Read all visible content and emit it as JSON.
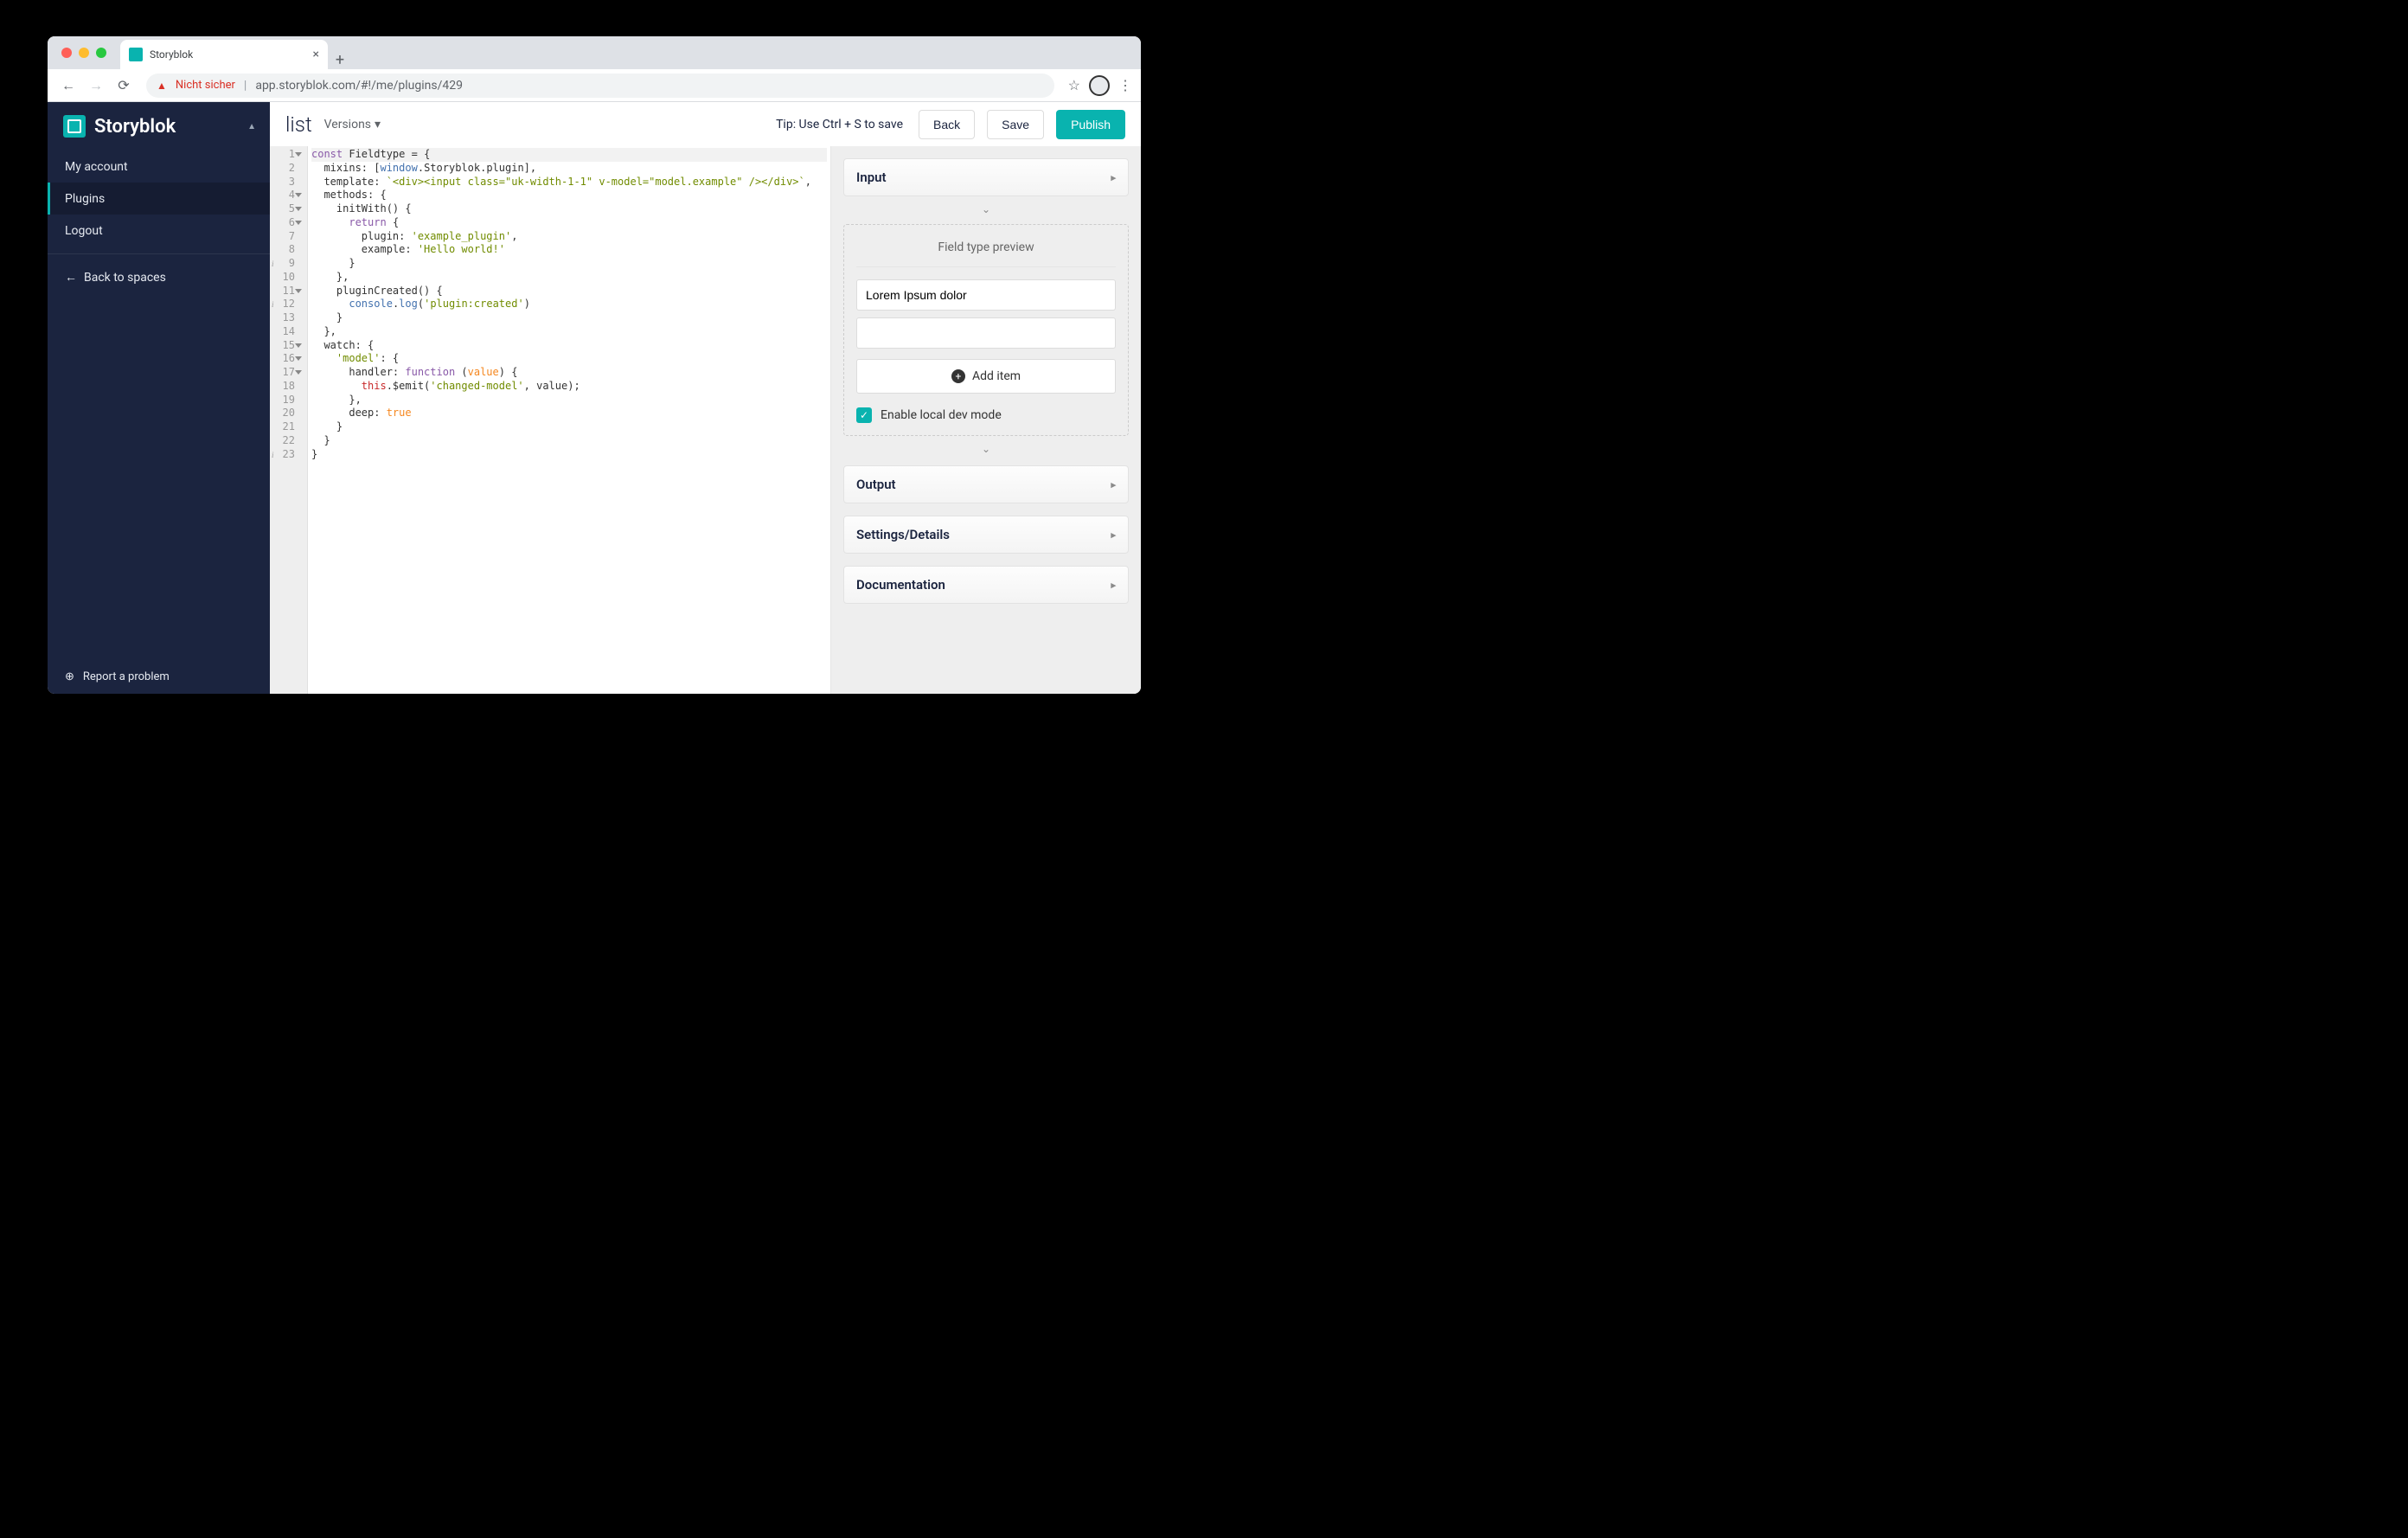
{
  "browser": {
    "tab_title": "Storyblok",
    "insecure_label": "Nicht sicher",
    "url": "app.storyblok.com/#!/me/plugins/429"
  },
  "sidebar": {
    "brand": "Storyblok",
    "items": [
      {
        "label": "My account",
        "active": false
      },
      {
        "label": "Plugins",
        "active": true
      },
      {
        "label": "Logout",
        "active": false
      }
    ],
    "back_label": "Back to spaces",
    "report_label": "Report a problem"
  },
  "topbar": {
    "title": "list",
    "versions_label": "Versions",
    "tip": "Tip: Use Ctrl + S to save",
    "back": "Back",
    "save": "Save",
    "publish": "Publish"
  },
  "editor": {
    "fold_lines": [
      1,
      4,
      5,
      6,
      11,
      15,
      16,
      17
    ],
    "warn_lines": [
      9,
      12,
      23
    ],
    "line_count": 23,
    "code_html": "<span class=\"first-line-hl\"><span class=\"tok-kw\">const</span> Fieldtype <span>=</span> {</span>\n  mixins: [<span class=\"tok-prop\">window</span>.Storyblok.plugin],\n  template: <span class=\"tok-str\">`&lt;div&gt;&lt;input class=\"uk-width-1-1\" v-model=\"model.example\" /&gt;&lt;/div&gt;`</span>,\n  methods: {\n    initWith() {\n      <span class=\"tok-kw\">return</span> {\n        plugin: <span class=\"tok-str\">'example_plugin'</span>,\n        example: <span class=\"tok-str\">'Hello world!'</span>\n      }\n    },\n    pluginCreated() {\n      <span class=\"tok-prop\">console</span>.<span class=\"tok-fn\">log</span>(<span class=\"tok-str\">'plugin:created'</span>)\n    }\n  },\n  watch: {\n    <span class=\"tok-str\">'model'</span>: {\n      handler: <span class=\"tok-kw\">function</span> (<span class=\"tok-num\">value</span>) {\n        <span class=\"tok-this\">this</span>.$emit(<span class=\"tok-str\">'changed-model'</span>, value);\n      },\n      deep: <span class=\"tok-bool\">true</span>\n    }\n  }\n}"
  },
  "panel": {
    "input_header": "Input",
    "preview_title": "Field type preview",
    "preview_value": "Lorem Ipsum dolor",
    "add_item": "Add item",
    "dev_mode_label": "Enable local dev mode",
    "dev_mode_checked": true,
    "output_header": "Output",
    "settings_header": "Settings/Details",
    "docs_header": "Documentation"
  }
}
